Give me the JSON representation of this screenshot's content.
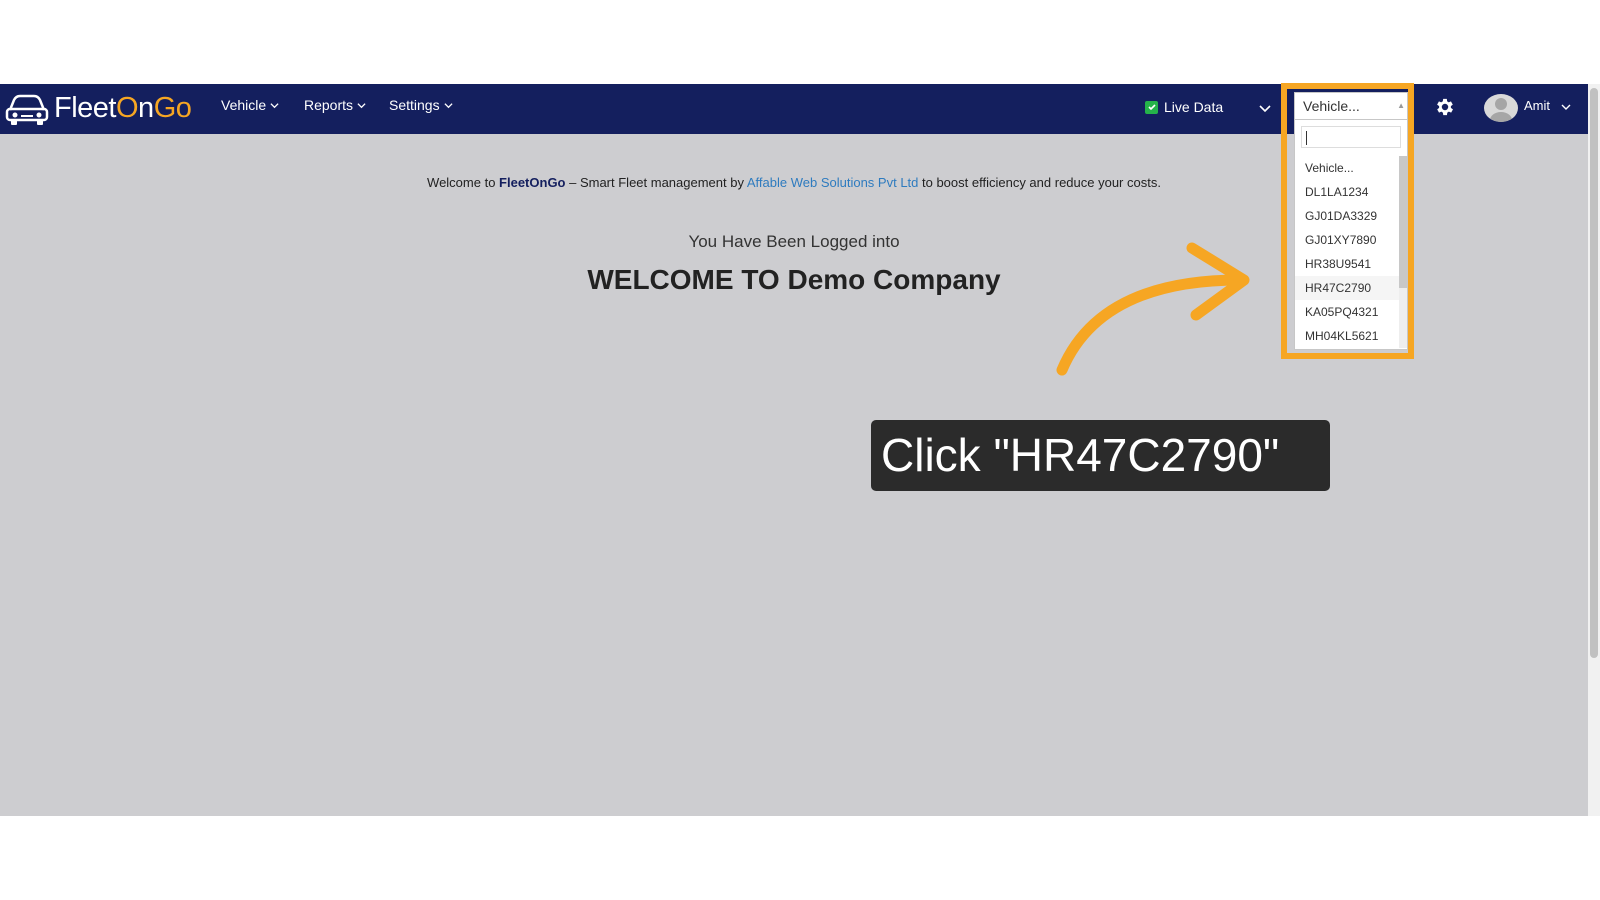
{
  "app": {
    "logo_prefix": "Fleet",
    "logo_o": "O",
    "logo_middle": "n",
    "logo_go": "Go"
  },
  "nav": {
    "vehicle": "Vehicle",
    "reports": "Reports",
    "settings": "Settings"
  },
  "toolbar": {
    "live_data": "Live Data",
    "live_data_checked": true
  },
  "vehicle_select": {
    "value": "Vehicle...",
    "options": [
      "Vehicle...",
      "DL1LA1234",
      "GJ01DA3329",
      "GJ01XY7890",
      "HR38U9541",
      "HR47C2790",
      "KA05PQ4321",
      "MH04KL5621"
    ],
    "highlighted": "HR47C2790"
  },
  "user": {
    "name": "Amit"
  },
  "main": {
    "welcome_prefix": "Welcome to ",
    "welcome_brand": "FleetOnGo",
    "welcome_mid": " – Smart Fleet management by ",
    "welcome_company": "Affable Web Solutions Pvt Ltd",
    "welcome_suffix": " to boost efficiency and reduce your costs.",
    "logged_into": "You Have Been Logged into",
    "heading": "WELCOME TO Demo Company"
  },
  "annotation": {
    "callout": "Click \"HR47C2790\"",
    "accent_color": "#f6a623"
  },
  "colors": {
    "navbar": "#141f5e",
    "content_bg": "#cdcdd0",
    "link": "#2e7bbf",
    "check": "#25b24a"
  }
}
